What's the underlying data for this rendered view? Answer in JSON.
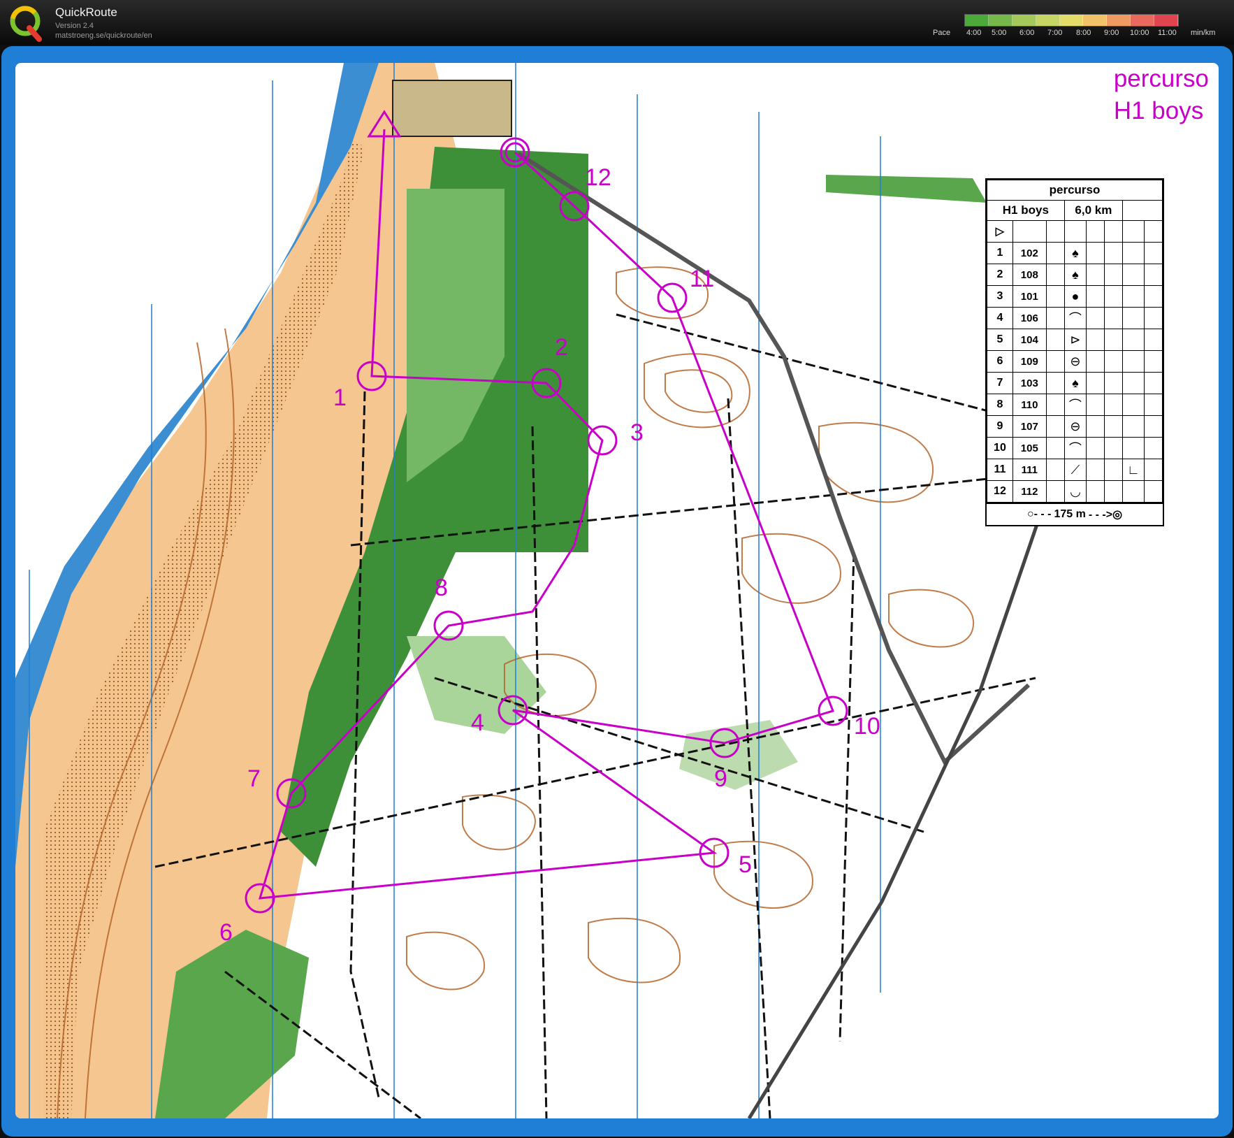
{
  "app": {
    "name": "QuickRoute",
    "version": "Version 2.4",
    "url": "matstroeng.se/quickroute/en"
  },
  "pace": {
    "label": "Pace",
    "ticks": [
      "4:00",
      "5:00",
      "6:00",
      "7:00",
      "8:00",
      "9:00",
      "10:00",
      "11:00",
      "min/km"
    ],
    "colors": [
      "#4caa3a",
      "#76b84a",
      "#a4c85a",
      "#c6d565",
      "#e4dc6a",
      "#f2c26a",
      "#ef9a63",
      "#e86a5c",
      "#e0454f"
    ]
  },
  "map": {
    "title_line1": "percurso",
    "title_line2": "H1 boys",
    "course_color": "#c800c8",
    "controls": [
      {
        "label": "1"
      },
      {
        "label": "2"
      },
      {
        "label": "3"
      },
      {
        "label": "4"
      },
      {
        "label": "5"
      },
      {
        "label": "6"
      },
      {
        "label": "7"
      },
      {
        "label": "8"
      },
      {
        "label": "9"
      },
      {
        "label": "10"
      },
      {
        "label": "11"
      },
      {
        "label": "12"
      }
    ]
  },
  "description": {
    "title": "percurso",
    "class": "H1 boys",
    "length": "6,0 km",
    "start_symbol": "▷",
    "rows": [
      {
        "num": "1",
        "code": "102",
        "symbol": "♠"
      },
      {
        "num": "2",
        "code": "108",
        "symbol": "♠"
      },
      {
        "num": "3",
        "code": "101",
        "symbol": "●"
      },
      {
        "num": "4",
        "code": "106",
        "symbol": "⌒"
      },
      {
        "num": "5",
        "code": "104",
        "symbol": "⊳"
      },
      {
        "num": "6",
        "code": "109",
        "symbol": "⊖"
      },
      {
        "num": "7",
        "code": "103",
        "symbol": "♠"
      },
      {
        "num": "8",
        "code": "110",
        "symbol": "⌒"
      },
      {
        "num": "9",
        "code": "107",
        "symbol": "⊖"
      },
      {
        "num": "10",
        "code": "105",
        "symbol": "⌒"
      },
      {
        "num": "11",
        "code": "111",
        "symbol": "⟋",
        "extra": "∟"
      },
      {
        "num": "12",
        "code": "112",
        "symbol": "◡"
      }
    ],
    "finish": "175 m"
  }
}
